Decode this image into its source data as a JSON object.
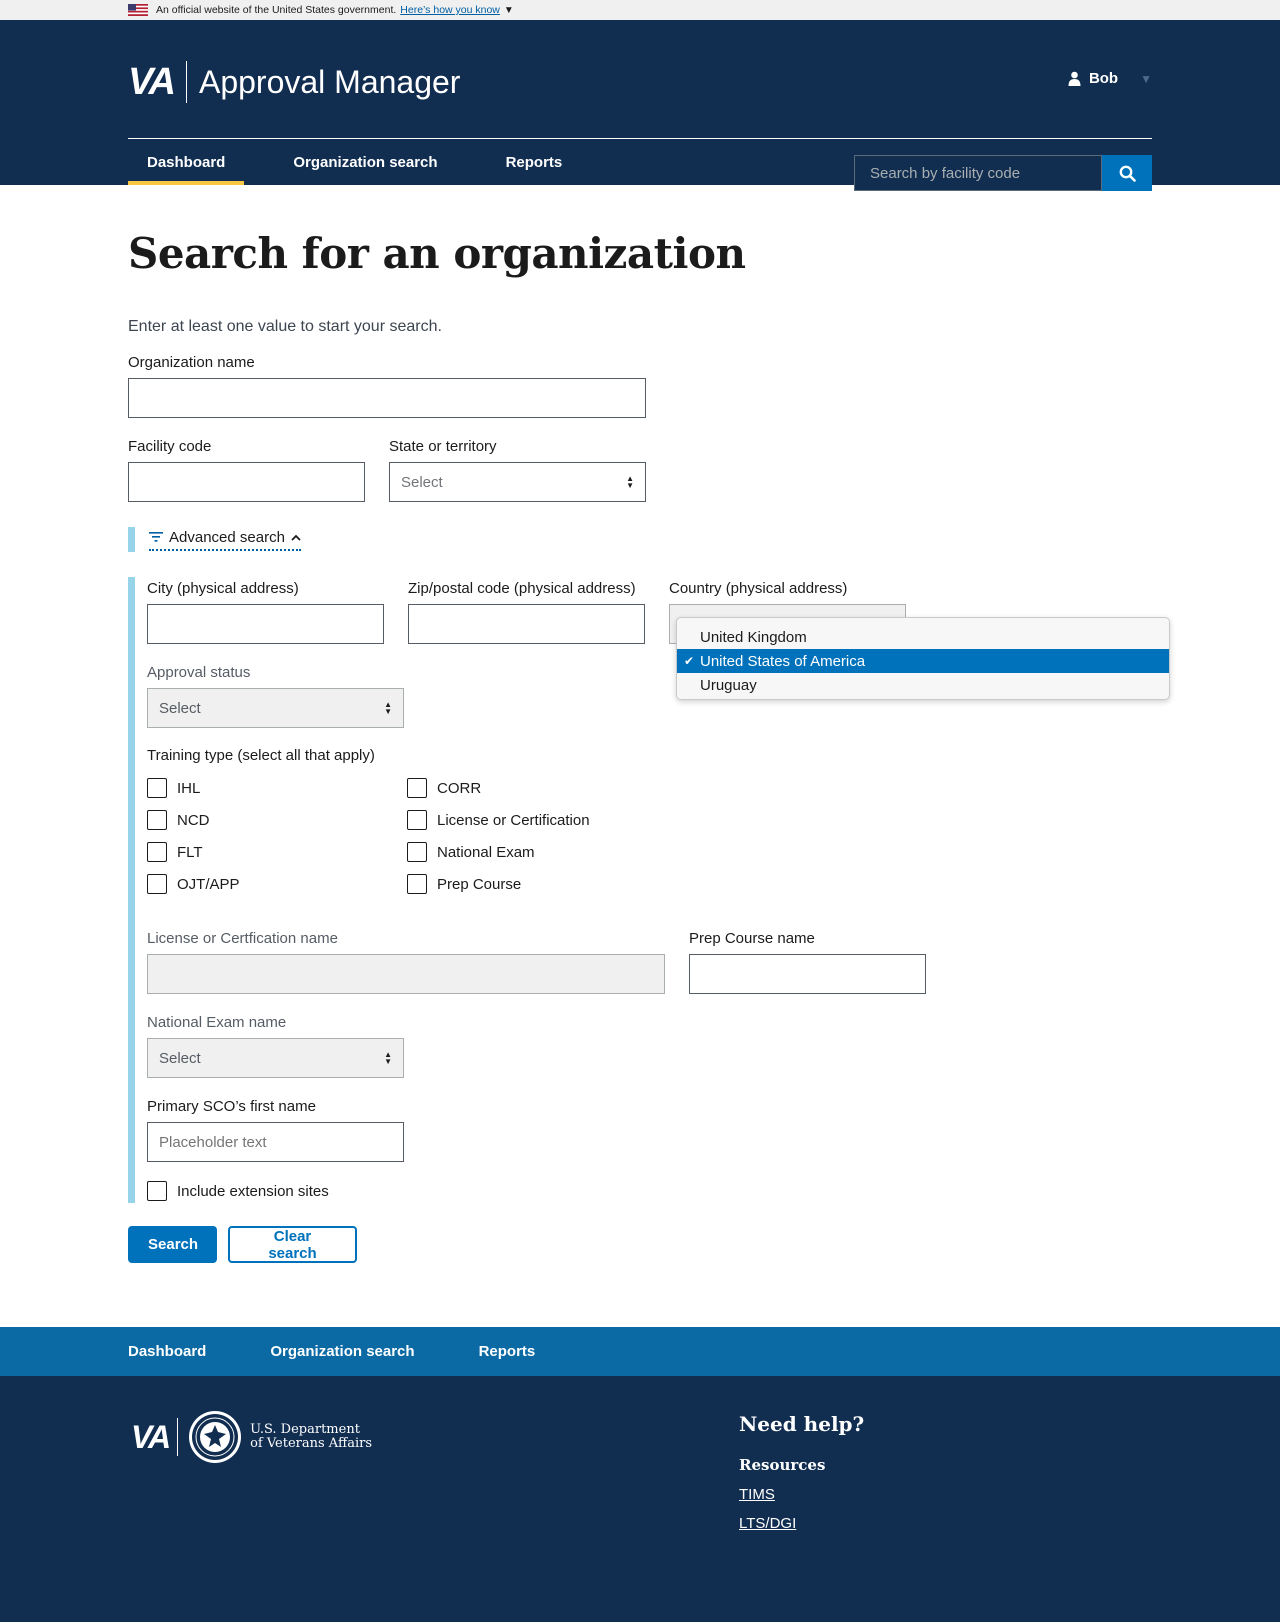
{
  "banner": {
    "text": "An official website of the United States government.",
    "link": "Here’s how you know"
  },
  "header": {
    "logo": "VA",
    "app_title": "Approval Manager",
    "user_name": "Bob",
    "nav": [
      {
        "label": "Dashboard",
        "active": true
      },
      {
        "label": "Organization search",
        "active": false
      },
      {
        "label": "Reports",
        "active": false
      }
    ],
    "search_placeholder": "Search by facility code"
  },
  "page": {
    "title": "Search for an organization",
    "intro": "Enter at least one value to start your search."
  },
  "form": {
    "org_name_label": "Organization name",
    "facility_code_label": "Facility code",
    "state_label": "State or territory",
    "state_value": "Select",
    "advanced_toggle": "Advanced search",
    "city_label": "City (physical address)",
    "zip_label": "Zip/postal code (physical address)",
    "country_label": "Country (physical address)",
    "country_options": [
      "United Kingdom",
      "United States of America",
      "Uruguay"
    ],
    "country_selected": "United States of America",
    "approval_label": "Approval status",
    "approval_value": "Select",
    "training_label": "Training type (select all that apply)",
    "training_col1": [
      "IHL",
      "NCD",
      "FLT",
      "OJT/APP"
    ],
    "training_col2": [
      "CORR",
      "License or Certification",
      "National Exam",
      "Prep Course"
    ],
    "license_label": "License or Certfication name",
    "prep_label": "Prep Course name",
    "exam_label": "National Exam name",
    "exam_value": "Select",
    "sco_label": "Primary SCO’s first name",
    "sco_placeholder": "Placeholder text",
    "extension_label": "Include extension sites",
    "search_button": "Search",
    "clear_button": "Clear search"
  },
  "footer": {
    "nav": [
      "Dashboard",
      "Organization search",
      "Reports"
    ],
    "logo": "VA",
    "dept_line1": "U.S. Department",
    "dept_line2": "of Veterans Affairs",
    "help_title": "Need help?",
    "resources_title": "Resources",
    "links": [
      "TIMS",
      "LTS/DGI"
    ]
  },
  "colors": {
    "header_bg": "#112e51",
    "primary": "#0071bb",
    "accent": "#f9c642",
    "advanced_bar": "#97d4ea",
    "footer_nav_bg": "#0b6aa3"
  }
}
